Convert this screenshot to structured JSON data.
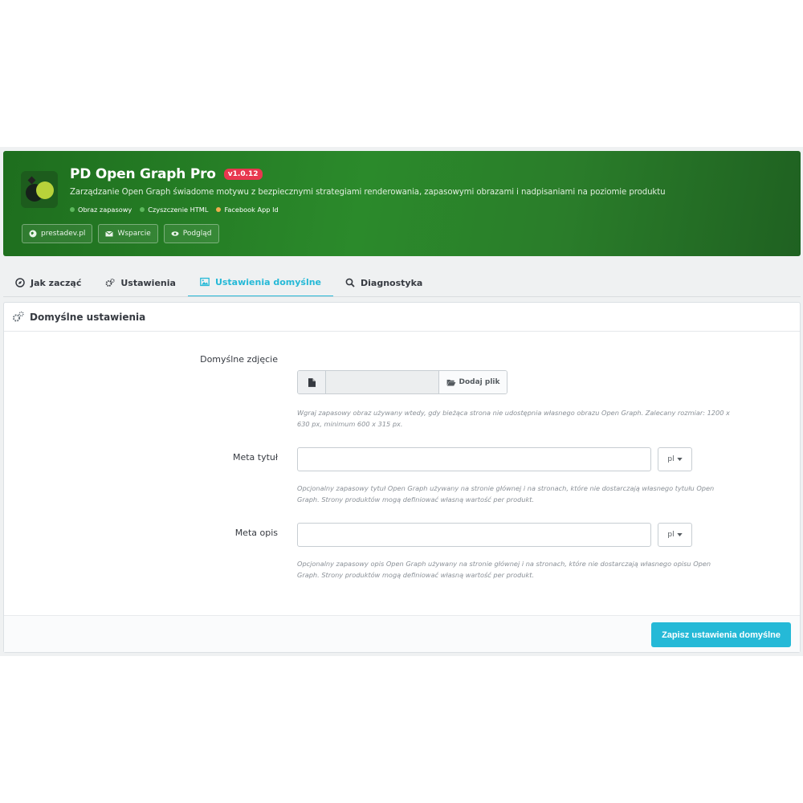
{
  "header": {
    "title": "PD Open Graph Pro",
    "version": "v1.0.12",
    "subtitle": "Zarządzanie Open Graph świadome motywu z bezpiecznymi strategiami renderowania, zapasowymi obrazami i nadpisaniami na poziomie produktu",
    "features": [
      {
        "label": "Obraz zapasowy",
        "color": "#5cb85c"
      },
      {
        "label": "Czyszczenie HTML",
        "color": "#5cb85c"
      },
      {
        "label": "Facebook App Id",
        "color": "#f0ad4e"
      }
    ],
    "links": [
      {
        "label": "prestadev.pl",
        "icon": "globe-icon"
      },
      {
        "label": "Wsparcie",
        "icon": "envelope-icon"
      },
      {
        "label": "Podgląd",
        "icon": "eye-icon"
      }
    ]
  },
  "tabs": [
    {
      "label": "Jak zacząć",
      "icon": "compass-icon",
      "active": false
    },
    {
      "label": "Ustawienia",
      "icon": "cogs-icon",
      "active": false
    },
    {
      "label": "Ustawienia domyślne",
      "icon": "image-icon",
      "active": true
    },
    {
      "label": "Diagnostyka",
      "icon": "search-icon",
      "active": false
    }
  ],
  "panel": {
    "title": "Domyślne ustawienia",
    "image_field": {
      "label": "Domyślne zdjęcie",
      "button_label": "Dodaj plik",
      "help": "Wgraj zapasowy obraz używany wtedy, gdy bieżąca strona nie udostępnia własnego obrazu Open Graph. Zalecany rozmiar: 1200 x 630 px, minimum 600 x 315 px."
    },
    "meta_title": {
      "label": "Meta tytuł",
      "value": "",
      "lang": "pl",
      "help": "Opcjonalny zapasowy tytuł Open Graph używany na stronie głównej i na stronach, które nie dostarczają własnego tytułu Open Graph. Strony produktów mogą definiować własną wartość per produkt."
    },
    "meta_description": {
      "label": "Meta opis",
      "value": "",
      "lang": "pl",
      "help": "Opcjonalny zapasowy opis Open Graph używany na stronie głównej i na stronach, które nie dostarczają własnego opisu Open Graph. Strony produktów mogą definiować własną wartość per produkt."
    },
    "save_label": "Zapisz ustawienia domyślne"
  },
  "colors": {
    "accent": "#25b9d7",
    "banner": "#2b8a2b",
    "version_badge": "#e8374f"
  }
}
